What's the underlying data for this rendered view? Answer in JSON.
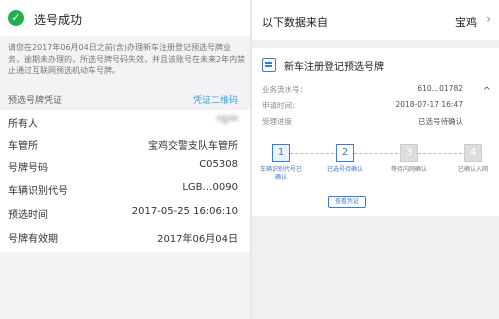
{
  "left": {
    "success_title": "选号成功",
    "notice": "请您在2017年06月04日之前(含)办理新车注册登记预选号牌业务，逾期未办理的，所选号牌号码失效，并且该账号在未来2年内禁止通过互联网预选机动车号牌。",
    "cert_label": "预选号牌凭证",
    "cert_link": "凭证二维码",
    "rows": [
      {
        "label": "所有人",
        "value": "*1**"
      },
      {
        "label": "车管所",
        "value": "宝鸡交警支队车管所"
      },
      {
        "label": "号牌号码",
        "value": "C05308"
      },
      {
        "label": "车辆识别代号",
        "value": "LGB…0090"
      },
      {
        "label": "预选时间",
        "value": "2017-05-25 16:06:10"
      },
      {
        "label": "号牌有效期",
        "value": "2017年06月04日"
      }
    ]
  },
  "right": {
    "source_label": "以下数据来自",
    "source_city": "宝鸡",
    "card_title": "新车注册登记预选号牌",
    "serial_label": "业务流水号：",
    "serial_value": "610…01782",
    "apply_label": "申请时间：",
    "apply_value": "2018-07-17 16:47",
    "progress_label": "受理进度",
    "progress_value": "已选号待确认",
    "steps": [
      {
        "num": "1",
        "caption": "车辆识别代号已确认",
        "state": "done"
      },
      {
        "num": "2",
        "caption": "已选号待确认",
        "state": "current"
      },
      {
        "num": "3",
        "caption": "等待内网确认",
        "state": "pending"
      },
      {
        "num": "4",
        "caption": "已确认入网",
        "state": "pending"
      }
    ],
    "view_button": "查看凭证"
  },
  "icons": {
    "success": "check-circle-icon",
    "chevron": "chevron-right-icon",
    "caret": "caret-up-icon",
    "card": "document-icon"
  },
  "colors": {
    "success_green": "#22b14c",
    "link_blue": "#3aa0d8",
    "accent_blue": "#3a7bd5"
  }
}
